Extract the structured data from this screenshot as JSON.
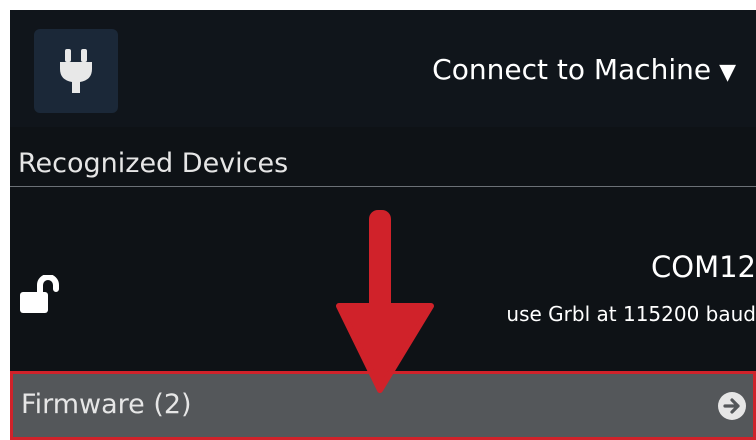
{
  "header": {
    "plug_icon": "plug-icon",
    "connect_label": "Connect to Machine",
    "connect_caret": "▼"
  },
  "devices": {
    "section_title": "Recognized Devices",
    "items": [
      {
        "icon": "unlock-icon",
        "port": "COM12",
        "description": "use Grbl at 115200 baud"
      }
    ]
  },
  "firmware": {
    "label": "Firmware (2)",
    "icon": "arrow-circle-right-icon"
  },
  "annotation": {
    "icon": "red-arrow-down-icon",
    "color": "#d0222a"
  },
  "colors": {
    "background": "#0e1216",
    "header_background": "#10151b",
    "plug_button": "#1b2838",
    "firmware_row": "#54575a",
    "highlight_border": "#d0222a"
  }
}
